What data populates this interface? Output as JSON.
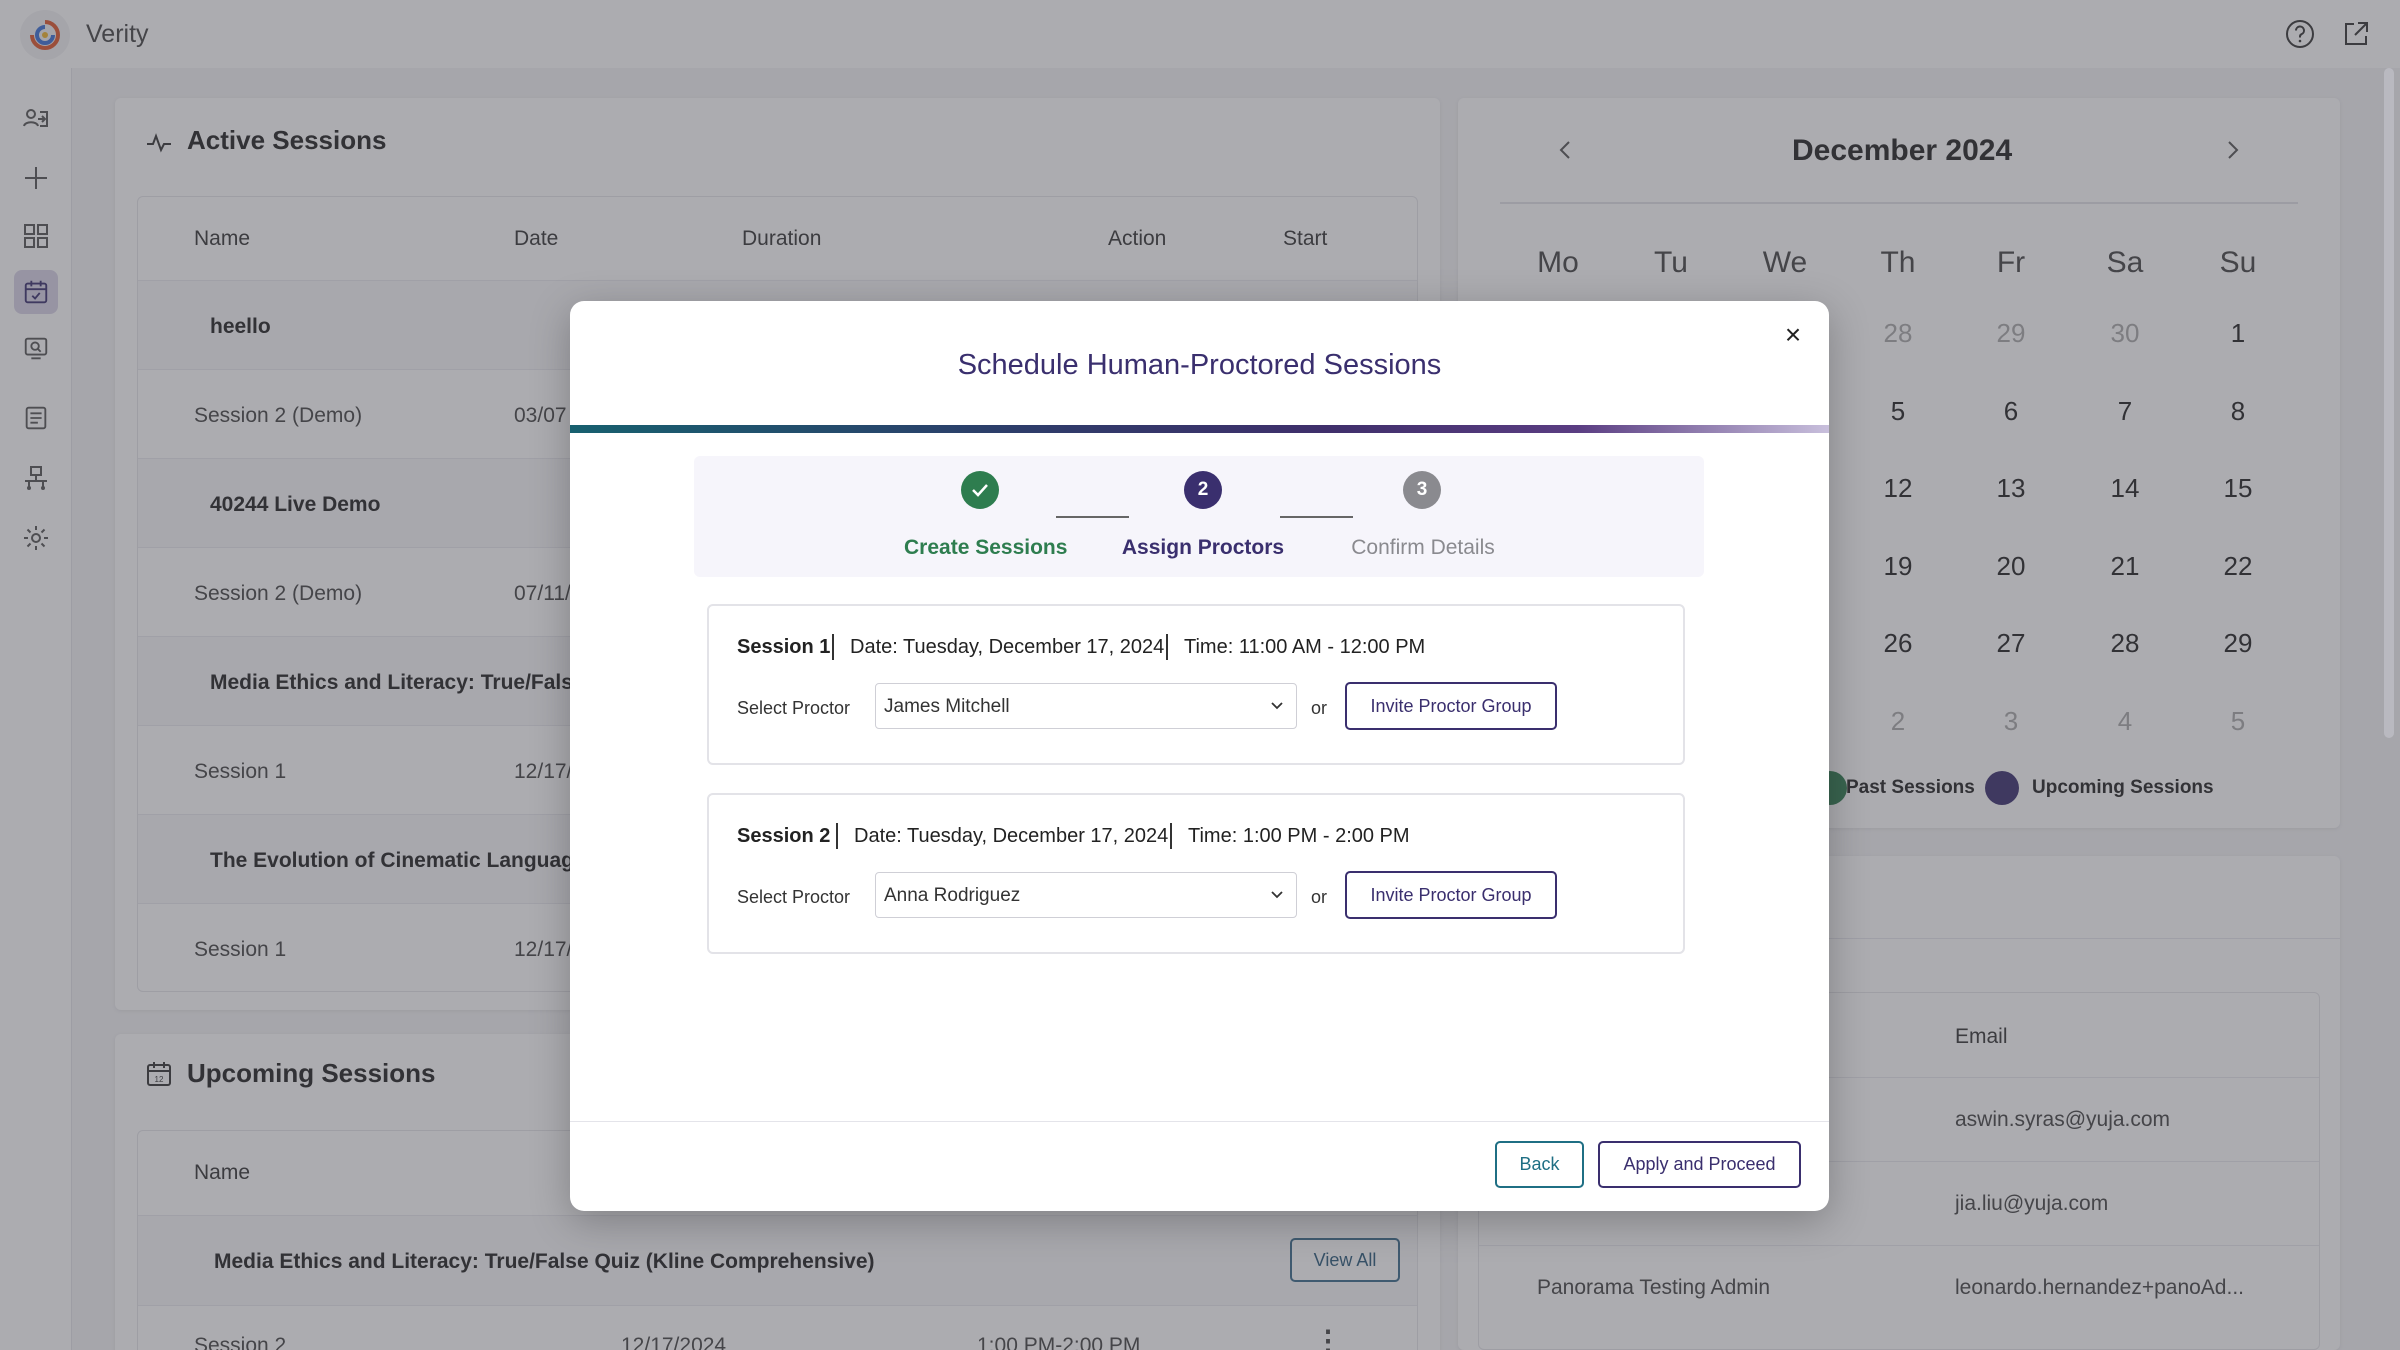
{
  "app": {
    "name": "Verity"
  },
  "active_sessions": {
    "title": "Active Sessions",
    "columns": [
      "Name",
      "Date",
      "Duration",
      "Action",
      "Start"
    ],
    "rows": [
      {
        "name": "heello",
        "date": "",
        "group": true
      },
      {
        "name": "Session 2 (Demo)",
        "date": "03/07",
        "group": false
      },
      {
        "name": "40244 Live Demo",
        "date": "",
        "group": true
      },
      {
        "name": "Session 2 (Demo)",
        "date": "07/11/",
        "group": false
      },
      {
        "name": "Media Ethics and Literacy: True/Fals",
        "date": "",
        "group": true
      },
      {
        "name": "Session 1",
        "date": "12/17/",
        "group": false
      },
      {
        "name": "The Evolution of Cinematic Languag",
        "date": "",
        "group": true
      },
      {
        "name": "Session 1",
        "date": "12/17/",
        "group": false
      }
    ]
  },
  "upcoming_sessions": {
    "title": "Upcoming Sessions",
    "columns": [
      "Name"
    ],
    "group_name": "Media Ethics and Literacy: True/False Quiz (Kline Comprehensive)",
    "view_all_label": "View All",
    "row": {
      "name": "Session 2",
      "date": "12/17/2024",
      "time": "1:00 PM-2:00 PM"
    }
  },
  "calendar": {
    "month_label": "December 2024",
    "days_of_week": [
      "Mo",
      "Tu",
      "We",
      "Th",
      "Fr",
      "Sa",
      "Su"
    ],
    "visible_weeks": [
      [
        "28",
        "29",
        "30",
        "1"
      ],
      [
        "5",
        "6",
        "7",
        "8"
      ],
      [
        "12",
        "13",
        "14",
        "15"
      ],
      [
        "19",
        "20",
        "21",
        "22"
      ],
      [
        "26",
        "27",
        "28",
        "29"
      ],
      [
        "2",
        "3",
        "4",
        "5"
      ]
    ],
    "legend": [
      {
        "label": "Past Sessions",
        "color": "#2e7d4f"
      },
      {
        "label": "Upcoming Sessions",
        "color": "#3a2f6e"
      }
    ]
  },
  "proctors": {
    "columns": [
      "Email"
    ],
    "rows": [
      {
        "name": "",
        "email": "aswin.syras@yuja.com"
      },
      {
        "name": "",
        "email": "jia.liu@yuja.com"
      },
      {
        "name": "Panorama Testing Admin",
        "email": "leonardo.hernandez+panoAd..."
      }
    ]
  },
  "modal": {
    "title": "Schedule Human-Proctored Sessions",
    "close_glyph": "×",
    "steps": [
      {
        "number": "✓",
        "label": "Create Sessions",
        "state": "done"
      },
      {
        "number": "2",
        "label": "Assign Proctors",
        "state": "current"
      },
      {
        "number": "3",
        "label": "Confirm Details",
        "state": "pending"
      }
    ],
    "sessions": [
      {
        "label": "Session 1",
        "date": "Date: Tuesday, December 17, 2024",
        "time": "Time: 11:00 AM - 12:00 PM",
        "select_label": "Select Proctor",
        "proctor": "James Mitchell",
        "or": "or",
        "invite_label": "Invite Proctor Group"
      },
      {
        "label": "Session 2",
        "date": "Date: Tuesday, December 17, 2024",
        "time": "Time: 1:00 PM - 2:00 PM",
        "select_label": "Select Proctor",
        "proctor": "Anna Rodriguez",
        "or": "or",
        "invite_label": "Invite Proctor Group"
      }
    ],
    "back_label": "Back",
    "apply_label": "Apply and Proceed"
  },
  "colors": {
    "brand": "#3a2f6e",
    "success": "#2e7d4f",
    "teal": "#1f6f84"
  }
}
